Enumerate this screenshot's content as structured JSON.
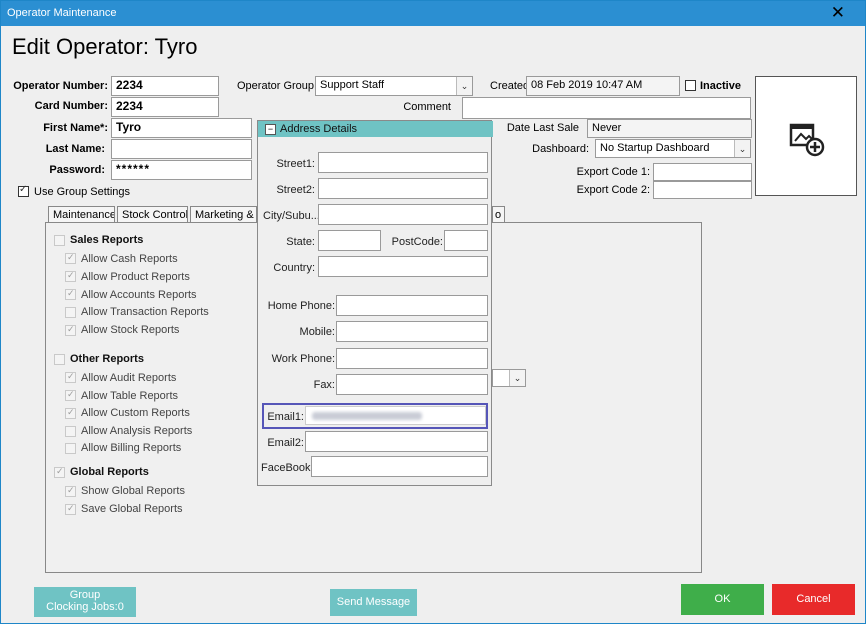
{
  "window": {
    "title": "Operator Maintenance",
    "close_glyph": "✕"
  },
  "heading": "Edit Operator: Tyro",
  "fields": {
    "operator_number_label": "Operator Number:",
    "operator_number": "2234",
    "card_number_label": "Card Number:",
    "card_number": "2234",
    "first_name_label": "First Name*:",
    "first_name": "Tyro",
    "last_name_label": "Last Name:",
    "last_name": "",
    "password_label": "Password:",
    "password": "******",
    "operator_group_label": "Operator Group:",
    "operator_group": "Support Staff",
    "created_label": "Created",
    "created": "08 Feb 2019 10:47 AM",
    "inactive_label": "Inactive",
    "comment_label": "Comment",
    "date_last_sale_label": "Date Last Sale",
    "date_last_sale": "Never",
    "dashboard_label": "Dashboard:",
    "dashboard": "No Startup Dashboard",
    "export_code1_label": "Export Code 1:",
    "export_code2_label": "Export Code 2:",
    "use_group_settings_label": "Use Group Settings",
    "use_group_settings_checked": true,
    "inactive_checked": false
  },
  "tabs": [
    {
      "label": "Maintenance"
    },
    {
      "label": "Stock Control"
    },
    {
      "label": "Marketing & L"
    },
    {
      "label": "o"
    }
  ],
  "permissions": {
    "sales_reports": {
      "title": "Sales Reports",
      "items": [
        {
          "label": "Allow Cash Reports",
          "checked": true
        },
        {
          "label": "Allow Product Reports",
          "checked": true
        },
        {
          "label": "Allow Accounts Reports",
          "checked": true
        },
        {
          "label": "Allow Transaction Reports",
          "checked": false
        },
        {
          "label": "Allow Stock Reports",
          "checked": true
        }
      ]
    },
    "other_reports": {
      "title": "Other Reports",
      "items": [
        {
          "label": "Allow Audit Reports",
          "checked": true
        },
        {
          "label": "Allow Table Reports",
          "checked": true
        },
        {
          "label": "Allow Custom Reports",
          "checked": true
        },
        {
          "label": "Allow Analysis Reports",
          "checked": false
        },
        {
          "label": "Allow Billing Reports",
          "checked": false
        }
      ]
    },
    "global_reports": {
      "title": "Global Reports",
      "items": [
        {
          "label": "Show Global Reports",
          "checked": true
        },
        {
          "label": "Save Global Reports",
          "checked": true
        }
      ]
    }
  },
  "address_popup": {
    "title": "Address Details",
    "street1_label": "Street1:",
    "street2_label": "Street2:",
    "city_label": "City/Subu...",
    "state_label": "State:",
    "postcode_label": "PostCode:",
    "country_label": "Country:",
    "home_phone_label": "Home Phone:",
    "mobile_label": "Mobile:",
    "work_phone_label": "Work Phone:",
    "fax_label": "Fax:",
    "email1_label": "Email1:",
    "email2_label": "Email2:",
    "facebook_label": "FaceBook:"
  },
  "buttons": {
    "group_clocking": "Group\nClocking Jobs:0",
    "send_message": "Send Message",
    "ok": "OK",
    "cancel": "Cancel"
  },
  "colors": {
    "titlebar": "#2b8fd2",
    "ok": "#3fae4a",
    "cancel": "#e82a2a",
    "teal": "#6fc3c4"
  }
}
